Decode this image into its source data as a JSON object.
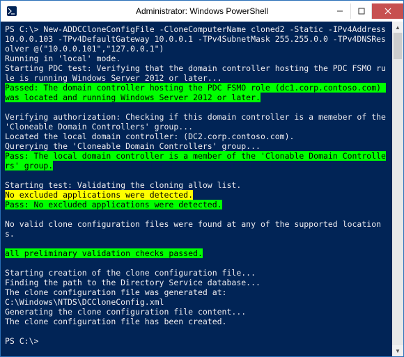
{
  "titlebar": {
    "title": "Administrator: Windows PowerShell"
  },
  "terminal": {
    "prompt": "PS C:\\>",
    "command": "New-ADDCCloneConfigFile -CloneComputerName cloned2 -Static -IPv4Address 10.0.0.103 -TPv4DefaultGateway 10.0.0.1 -TPv4SubnetMask 255.255.0.0 -TPv4DNSResolver @(\"10.0.0.101\",\"127.0.0.1\")",
    "lines": {
      "running": "Running in 'local' mode.",
      "pdc_start": "Starting PDC test: Verifying that the domain controller hosting the PDC FSMO rule is running Windows Server 2012 or later...",
      "pdc_pass": "Passed: The domain controller hosting the PDC FSMO role (dc1.corp.contoso.com) was located and running Windows Server 2012 or later.",
      "auth_verify": "Verifying authorization: Checking if this domain controller is a memeber of the 'Cloneable Domain Controllers' group...",
      "auth_located": "Located the local domain controller: (DC2.corp.contoso.com).",
      "auth_query": "Qurerying the 'Cloneable Domain Controllers' group...",
      "auth_pass": "Pass: The local domain controller is a member of the 'Clonable Domain Controllers' group.",
      "allow_start": "Starting test: Validating the cloning allow list.",
      "allow_none": "No excluded applications were detected.",
      "allow_pass": "Pass: No excluded applications were detected.",
      "no_valid": "No valid clone configuration files were found at any of the supported locations.",
      "all_prelim": "all preliminary validation checks passed.",
      "create_start": "Starting creation of the clone configuration file...",
      "create_find": "Finding the path to the Directory Service database...",
      "create_gen_at": "The clone configuration file was generated at:",
      "create_path": "C:\\Windows\\NTDS\\DCCloneConfig.xml",
      "create_content": "Generating the clone configuration file content...",
      "create_done": "The clone configuration file has been created."
    },
    "final_prompt": "PS C:\\>"
  }
}
